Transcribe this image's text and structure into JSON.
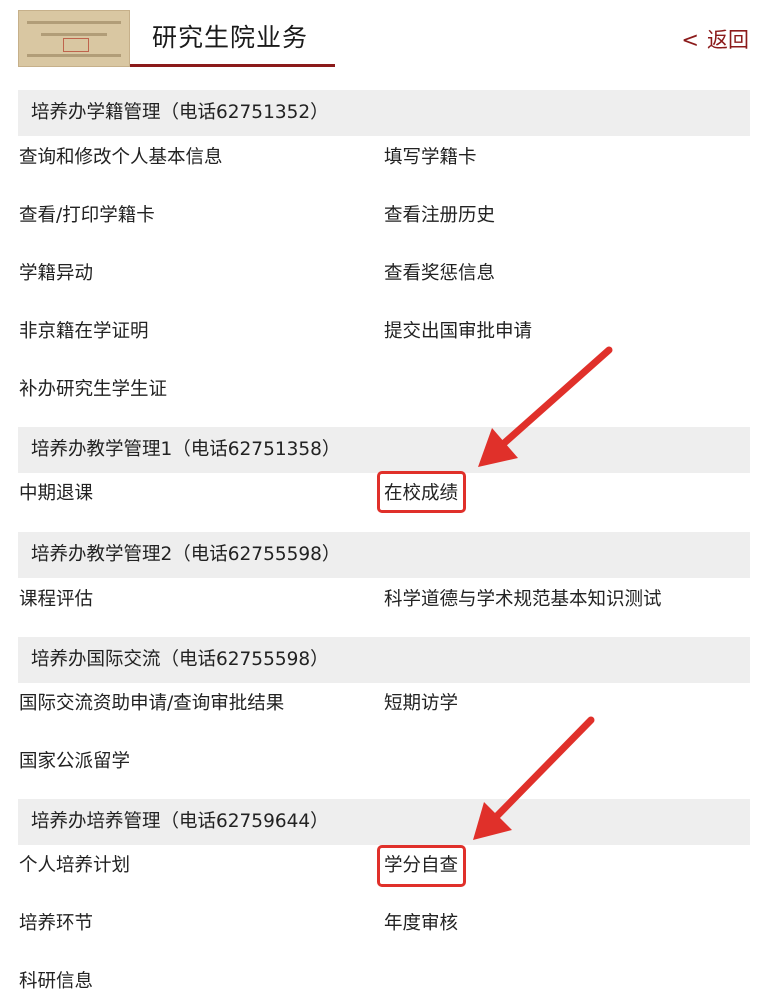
{
  "header": {
    "title": "研究生院业务",
    "back_label": "返回",
    "back_chevron": "<"
  },
  "colors": {
    "accent": "#8b1a1a",
    "section_bg": "#eeeeee",
    "annotation": "#e0302a"
  },
  "sections": [
    {
      "title": "培养办学籍管理（电话62751352）",
      "items": [
        "查询和修改个人基本信息",
        "填写学籍卡",
        "查看/打印学籍卡",
        "查看注册历史",
        "学籍异动",
        "查看奖惩信息",
        "非京籍在学证明",
        "提交出国审批申请",
        "补办研究生学生证"
      ]
    },
    {
      "title": "培养办教学管理1（电话62751358）",
      "items": [
        "中期退课",
        "在校成绩"
      ]
    },
    {
      "title": "培养办教学管理2（电话62755598）",
      "items": [
        "课程评估",
        "科学道德与学术规范基本知识测试"
      ]
    },
    {
      "title": "培养办国际交流（电话62755598）",
      "items": [
        "国际交流资助申请/查询审批结果",
        "短期访学",
        "国家公派留学"
      ]
    },
    {
      "title": "培养办培养管理（电话62759644）",
      "items": [
        "个人培养计划",
        "学分自查",
        "培养环节",
        "年度审核",
        "科研信息"
      ]
    }
  ]
}
